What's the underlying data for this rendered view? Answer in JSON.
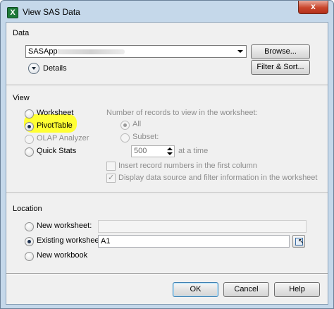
{
  "window": {
    "title": "View SAS Data",
    "close_glyph": "x",
    "app_icon_glyph": "X"
  },
  "data_section": {
    "label": "Data",
    "server_value": "SASApp:",
    "browse_label": "Browse...",
    "details_label": "Details",
    "filter_sort_label": "Filter & Sort..."
  },
  "view_section": {
    "label": "View",
    "options": {
      "worksheet": "Worksheet",
      "pivot_table": "PivotTable",
      "olap_analyzer": "OLAP Analyzer",
      "quick_stats": "Quick Stats"
    },
    "selected": "PivotTable",
    "records_label": "Number of records to view in the worksheet:",
    "all_label": "All",
    "subset_label": "Subset:",
    "subset_value": "500",
    "at_a_time_label": "at a time",
    "insert_record_numbers_label": "Insert record numbers in the first column",
    "insert_record_numbers_checked": false,
    "display_source_label": "Display data source and filter information in the worksheet",
    "display_source_checked": true
  },
  "location_section": {
    "label": "Location",
    "new_worksheet_label": "New worksheet:",
    "existing_worksheet_label": "Existing worksheet:",
    "existing_worksheet_value": "A1",
    "new_workbook_label": "New workbook",
    "selected": "Existing worksheet:"
  },
  "footer": {
    "ok_label": "OK",
    "cancel_label": "Cancel",
    "help_label": "Help"
  },
  "colors": {
    "highlight": "#ffff33",
    "title_bar": "#c5d8ea",
    "close_button": "#c9462c"
  }
}
